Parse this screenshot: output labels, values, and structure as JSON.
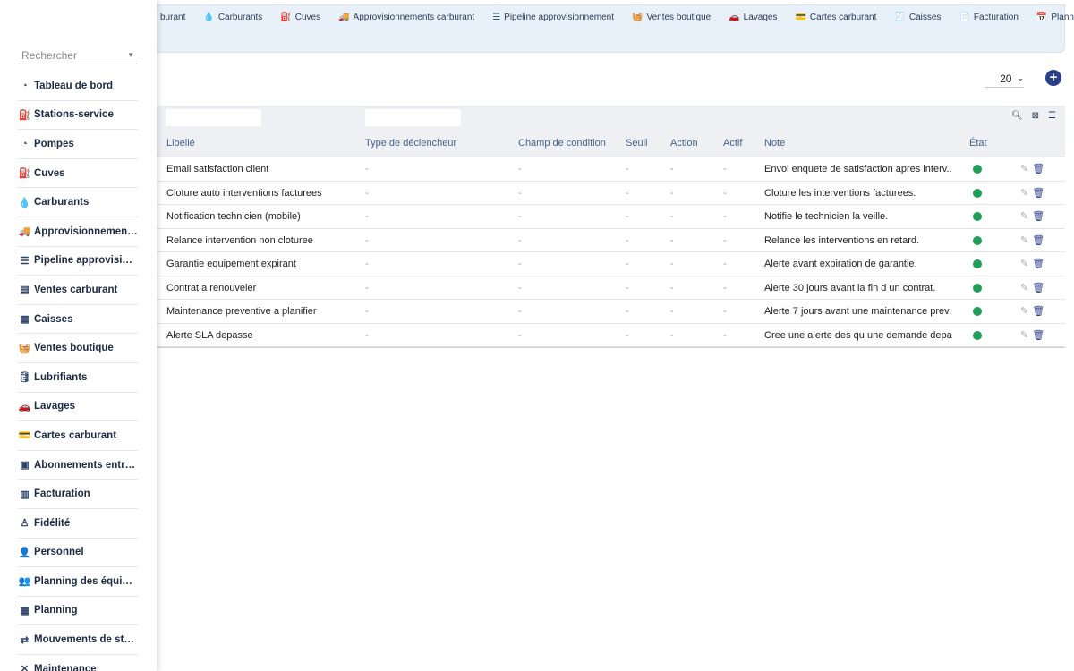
{
  "topmenu": [
    {
      "icon": "fuel-icon",
      "glyph": "",
      "label": "burant"
    },
    {
      "icon": "drop-icon",
      "glyph": "💧",
      "label": "Carburants"
    },
    {
      "icon": "tank-icon",
      "glyph": "⛽",
      "label": "Cuves"
    },
    {
      "icon": "truck-icon",
      "glyph": "🚚",
      "label": "Approvisionnements carburant"
    },
    {
      "icon": "pipeline-icon",
      "glyph": "☰",
      "label": "Pipeline approvisionnement"
    },
    {
      "icon": "basket-icon",
      "glyph": "🧺",
      "label": "Ventes boutique"
    },
    {
      "icon": "car-icon",
      "glyph": "🚗",
      "label": "Lavages"
    },
    {
      "icon": "card-icon",
      "glyph": "💳",
      "label": "Cartes carburant"
    },
    {
      "icon": "cashier-icon",
      "glyph": "🧾",
      "label": "Caisses"
    },
    {
      "icon": "invoice-icon",
      "glyph": "📄",
      "label": "Facturation"
    },
    {
      "icon": "calendar-icon",
      "glyph": "📅",
      "label": "Planning"
    }
  ],
  "sidebar": {
    "search_placeholder": "Rechercher",
    "items": [
      {
        "icon": "dashboard-icon",
        "glyph": "◔",
        "label": "Tableau de bord"
      },
      {
        "icon": "gas-station-icon",
        "glyph": "⛽",
        "label": "Stations-service"
      },
      {
        "icon": "pump-icon",
        "glyph": "◔",
        "label": "Pompes"
      },
      {
        "icon": "tank-icon",
        "glyph": "⛽",
        "label": "Cuves"
      },
      {
        "icon": "drop-icon",
        "glyph": "💧",
        "label": "Carburants"
      },
      {
        "icon": "truck-icon",
        "glyph": "🚚",
        "label": "Approvisionnements carburant"
      },
      {
        "icon": "pipeline-icon",
        "glyph": "☰",
        "label": "Pipeline approvisionnement"
      },
      {
        "icon": "receipt-icon",
        "glyph": "▤",
        "label": "Ventes carburant"
      },
      {
        "icon": "cashier-icon",
        "glyph": "▦",
        "label": "Caisses"
      },
      {
        "icon": "basket-icon",
        "glyph": "🧺",
        "label": "Ventes boutique"
      },
      {
        "icon": "oil-can-icon",
        "glyph": "🛢",
        "label": "Lubrifiants"
      },
      {
        "icon": "car-icon",
        "glyph": "🚗",
        "label": "Lavages"
      },
      {
        "icon": "card-icon",
        "glyph": "💳",
        "label": "Cartes carburant"
      },
      {
        "icon": "subscription-icon",
        "glyph": "▣",
        "label": "Abonnements entreprise"
      },
      {
        "icon": "invoice-icon",
        "glyph": "▥",
        "label": "Facturation"
      },
      {
        "icon": "loyalty-icon",
        "glyph": "♙",
        "label": "Fidélité"
      },
      {
        "icon": "staff-icon",
        "glyph": "👤",
        "label": "Personnel"
      },
      {
        "icon": "team-icon",
        "glyph": "👥",
        "label": "Planning des équipes"
      },
      {
        "icon": "calendar-icon",
        "glyph": "▦",
        "label": "Planning"
      },
      {
        "icon": "stock-icon",
        "glyph": "⇄",
        "label": "Mouvements de stock"
      },
      {
        "icon": "wrench-icon",
        "glyph": "✕",
        "label": "Maintenance"
      }
    ]
  },
  "pager": {
    "page_size": "20"
  },
  "table": {
    "headers": {
      "libelle": "Libellé",
      "type": "Type de déclencheur",
      "champ": "Champ de condition",
      "seuil": "Seuil",
      "action": "Action",
      "actif": "Actif",
      "note": "Note",
      "etat": "État"
    },
    "rows": [
      {
        "libelle": "Email satisfaction client",
        "type": "-",
        "champ": "-",
        "seuil": "-",
        "action": "-",
        "actif": "-",
        "note": "Envoi enquete de satisfaction apres interv..."
      },
      {
        "libelle": "Cloture auto interventions facturees",
        "type": "-",
        "champ": "-",
        "seuil": "-",
        "action": "-",
        "actif": "-",
        "note": "Cloture les interventions facturees."
      },
      {
        "libelle": "Notification technicien (mobile)",
        "type": "-",
        "champ": "-",
        "seuil": "-",
        "action": "-",
        "actif": "-",
        "note": "Notifie le technicien la veille."
      },
      {
        "libelle": "Relance intervention non cloturee",
        "type": "-",
        "champ": "-",
        "seuil": "-",
        "action": "-",
        "actif": "-",
        "note": "Relance les interventions en retard."
      },
      {
        "libelle": "Garantie equipement expirant",
        "type": "-",
        "champ": "-",
        "seuil": "-",
        "action": "-",
        "actif": "-",
        "note": "Alerte avant expiration de garantie."
      },
      {
        "libelle": "Contrat a renouveler",
        "type": "-",
        "champ": "-",
        "seuil": "-",
        "action": "-",
        "actif": "-",
        "note": "Alerte 30 jours avant la fin d un contrat."
      },
      {
        "libelle": "Maintenance preventive a planifier",
        "type": "-",
        "champ": "-",
        "seuil": "-",
        "action": "-",
        "actif": "-",
        "note": "Alerte 7 jours avant une maintenance prev..."
      },
      {
        "libelle": "Alerte SLA depasse",
        "type": "-",
        "champ": "-",
        "seuil": "-",
        "action": "-",
        "actif": "-",
        "note": "Cree une alerte des qu une demande depa..."
      }
    ],
    "status_color": "#1e9e57"
  }
}
